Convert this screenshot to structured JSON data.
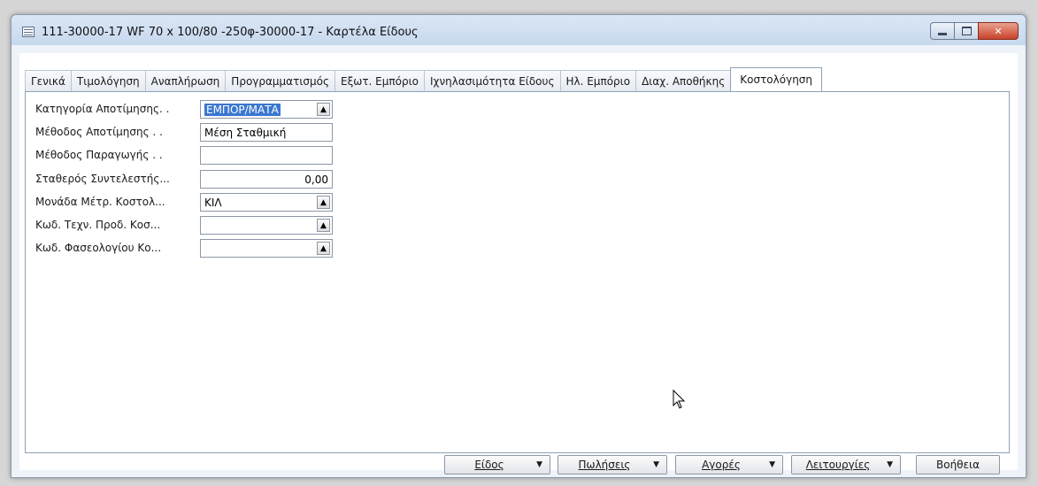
{
  "window": {
    "title": "111-30000-17 WF 70 x 100/80 -250φ-30000-17 - Καρτέλα Είδους"
  },
  "tabs": [
    {
      "label": "Γενικά"
    },
    {
      "label": "Τιμολόγηση"
    },
    {
      "label": "Αναπλήρωση"
    },
    {
      "label": "Προγραμματισμός"
    },
    {
      "label": "Εξωτ. Εμπόριο"
    },
    {
      "label": "Ιχνηλασιμότητα Είδους"
    },
    {
      "label": "Ηλ. Εμπόριο"
    },
    {
      "label": "Διαχ. Αποθήκης"
    },
    {
      "label": "Κοστολόγηση"
    }
  ],
  "active_tab_index": 8,
  "form": {
    "fields": [
      {
        "label": "Κατηγορία Αποτίμησης. .",
        "value": "ΕΜΠΟΡ/ΜΑΤΑ",
        "lookup": true,
        "selected": true
      },
      {
        "label": "Μέθοδος Αποτίμησης . .",
        "value": "Μέση Σταθμική",
        "lookup": false
      },
      {
        "label": "Μέθοδος Παραγωγής . .",
        "value": "",
        "lookup": false
      },
      {
        "label": "Σταθερός Συντελεστής...",
        "value": "0,00",
        "lookup": false,
        "numeric": true
      },
      {
        "label": "Μονάδα Μέτρ. Κοστολ...",
        "value": "ΚΙΛ",
        "lookup": true
      },
      {
        "label": "Κωδ. Τεχν. Προδ. Κοσ...",
        "value": "",
        "lookup": true
      },
      {
        "label": "Κωδ. Φασεολογίου Κο...",
        "value": "",
        "lookup": true
      }
    ]
  },
  "buttons": {
    "item": "Είδος",
    "sales": "Πωλήσεις",
    "purchases": "Αγορές",
    "functions": "Λειτουργίες",
    "help": "Βοήθεια"
  },
  "icons": {
    "dropdown": "▼",
    "lookup": "▲",
    "close": "✕"
  },
  "colors": {
    "selection": "#3a78d0",
    "close_button": "#c8432b"
  }
}
